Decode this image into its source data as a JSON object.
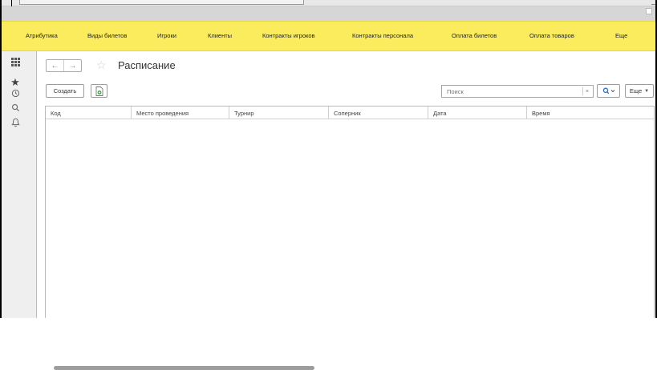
{
  "menu": {
    "items": [
      "Атрибутика",
      "Виды билетов",
      "Игроки",
      "Клиенты",
      "Контракты игроков",
      "Контракты персонала",
      "Оплата билетов",
      "Оплата товаров",
      "Еще"
    ],
    "background": "#fbec5d"
  },
  "sidebar": {
    "icons": [
      "apps-grid-icon",
      "favorites-star-icon",
      "history-clock-icon",
      "search-icon",
      "notifications-bell-icon"
    ]
  },
  "page": {
    "title": "Расписание"
  },
  "toolbar": {
    "create_label": "Создать",
    "search_placeholder": "Поиск",
    "search_clear": "×",
    "more_label": "Еще"
  },
  "table": {
    "columns": [
      "Код",
      "Место проведения",
      "Турнир",
      "Соперник",
      "Дата",
      "Время"
    ],
    "rows": []
  }
}
